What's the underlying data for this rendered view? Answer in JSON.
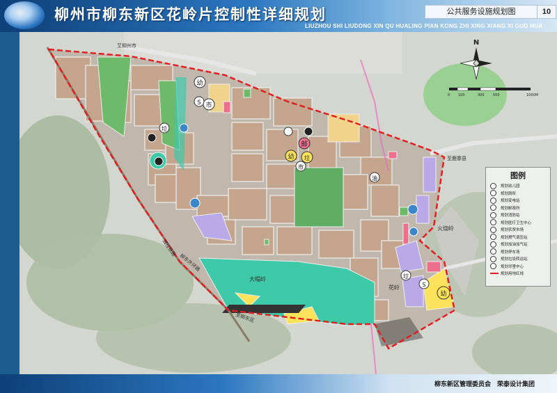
{
  "header": {
    "title_cn": "柳州市柳东新区花岭片控制性详细规划",
    "title_en": "LIUZHOU SHI LIUDONG XIN QU HUALING PIAN KONG ZHI XING XIANG XI GUO HUA",
    "sheet_title": "公共服务设施规划图",
    "sheet_number": "10"
  },
  "map_labels": {
    "road_1": "至柳州市",
    "road_2": "湘桂铁路",
    "road_3": "柳东外环路",
    "road_4": "至柳东区",
    "road_5": "至鹿寨县",
    "place_1": "火烧岭",
    "place_2": "大帽岭",
    "place_3": "花岭"
  },
  "facility_labels": {
    "kindergarten": "幼",
    "market": "市",
    "sports": "S",
    "garbage": "垃",
    "post": "邮",
    "fuel": "油"
  },
  "north": {
    "label": "N"
  },
  "scale": {
    "labels": [
      "0",
      "100",
      "300",
      "500",
      "1000M"
    ]
  },
  "legend": {
    "title": "图例",
    "items": [
      "规划幼儿园",
      "规划厕所",
      "规划变电站",
      "规划邮政所",
      "规划消防站",
      "规划医疗卫生中心",
      "规划农贸市场",
      "规划燃气调压站",
      "规划加油加气站",
      "规划停车场",
      "规划垃圾转运站",
      "规划邻里中心",
      "规划用地红线"
    ]
  },
  "footer": {
    "org1": "柳东新区管理委员会",
    "org2": "荣泰设计集团"
  },
  "colors": {
    "residential": "#c4a68e",
    "water": "#3ec9a8",
    "greenspace": "#6fb96a",
    "education": "#fde35a",
    "commercial": "#ec6f8e",
    "public": "#b9a9e8",
    "boundary": "#e02020"
  }
}
